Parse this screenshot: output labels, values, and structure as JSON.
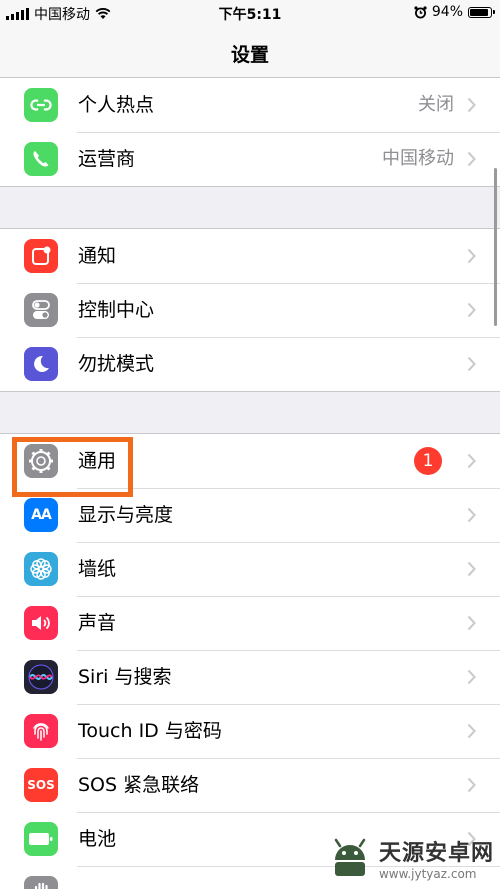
{
  "status_bar": {
    "carrier": "中国移动",
    "time": "下午5:11",
    "battery": "94%",
    "battery_level": 0.94
  },
  "nav": {
    "title": "设置"
  },
  "groups": [
    {
      "rows": [
        {
          "label": "个人热点",
          "value": "关闭",
          "icon": "hotspot-icon",
          "color": "#4cd964"
        },
        {
          "label": "运营商",
          "value": "中国移动",
          "icon": "phone-icon",
          "color": "#4cd964"
        }
      ]
    },
    {
      "rows": [
        {
          "label": "通知",
          "icon": "notifications-icon",
          "color": "#ff3b30"
        },
        {
          "label": "控制中心",
          "icon": "control-center-icon",
          "color": "#8e8e93"
        },
        {
          "label": "勿扰模式",
          "icon": "moon-icon",
          "color": "#5856d6"
        }
      ]
    },
    {
      "rows": [
        {
          "label": "通用",
          "badge": "1",
          "icon": "gear-icon",
          "color": "#8e8e93"
        },
        {
          "label": "显示与亮度",
          "icon": "display-brightness-icon",
          "color": "#007aff",
          "glyph": "AA"
        },
        {
          "label": "墙纸",
          "icon": "wallpaper-flower-icon",
          "color": "#34aadc"
        },
        {
          "label": "声音",
          "icon": "speaker-icon",
          "color": "#ff2d55"
        },
        {
          "label": "Siri 与搜索",
          "icon": "siri-icon",
          "color": "#222233"
        },
        {
          "label": "Touch ID 与密码",
          "icon": "fingerprint-icon",
          "color": "#ff2d55"
        },
        {
          "label": "SOS 紧急联络",
          "icon": "sos-icon",
          "color": "#ff3b30",
          "glyph": "SOS"
        },
        {
          "label": "电池",
          "icon": "battery-icon",
          "color": "#4cd964"
        },
        {
          "label": "",
          "icon": "privacy-hand-icon",
          "color": "#8e8e93"
        }
      ]
    }
  ],
  "watermark": {
    "title": "天源安卓网",
    "url": "www.jytyaz.com"
  }
}
